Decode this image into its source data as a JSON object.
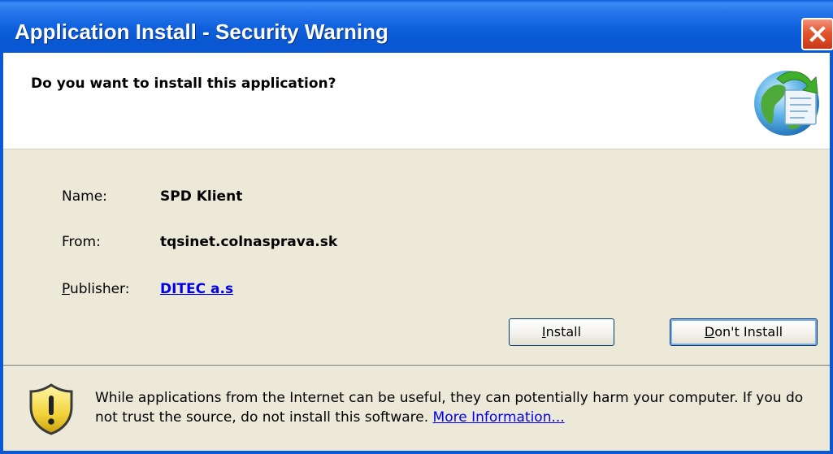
{
  "window": {
    "title": "Application Install - Security Warning"
  },
  "header": {
    "question": "Do you want to install this application?",
    "icon": "globe-install-icon"
  },
  "details": {
    "name_label": "Name:",
    "name_value": "SPD Klient",
    "from_label": "From:",
    "from_value": "tqsinet.colnasprava.sk",
    "publisher_label_underlined": "P",
    "publisher_label_rest": "ublisher:",
    "publisher_value": "DITEC a.s"
  },
  "buttons": {
    "install_mnemonic": "I",
    "install_rest": "nstall",
    "dont_install_mnemonic": "D",
    "dont_install_rest": "on't Install"
  },
  "footer": {
    "warning_text": "While applications from the Internet can be useful, they can potentially harm your computer. If you do not trust the source, do not install this software.",
    "more_info_link": "More Information...",
    "icon": "warning-shield-icon"
  },
  "colors": {
    "titlebar": "#0b58d6",
    "body_bg": "#ece9d8",
    "link": "#0000ee",
    "close_button": "#e3542d"
  }
}
